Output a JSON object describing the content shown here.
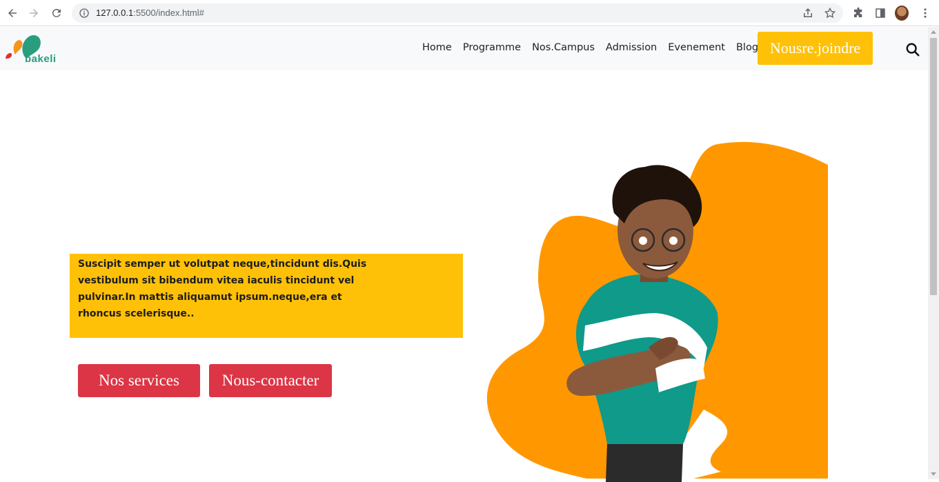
{
  "browser": {
    "url_host": "127.0.0.1",
    "url_rest": ":5500/index.html#"
  },
  "site": {
    "logo_text": "bakeli",
    "menu": [
      {
        "label": "Home"
      },
      {
        "label": "Programme"
      },
      {
        "label": "Nos.Campus"
      },
      {
        "label": "Admission"
      },
      {
        "label": "Evenement"
      },
      {
        "label": "Blog"
      }
    ],
    "join_label": "Nousre.joindre"
  },
  "hero": {
    "text": "Suscipit semper ut volutpat neque,tincidunt dis.Quis vestibulum sit bibendum vitea iaculis tincidunt vel pulvinar.In mattis aliquamut ipsum.neque,era et rhoncus scelerisque..",
    "services_label": "Nos services",
    "contact_label": "Nous-contacter"
  },
  "colors": {
    "accent_yellow": "#ffc107",
    "button_red": "#dc3545",
    "blob_orange": "#ff9800",
    "shirt_teal": "#0f9a8a"
  },
  "icons": [
    "back-arrow-icon",
    "forward-arrow-icon",
    "reload-icon",
    "info-icon",
    "share-icon",
    "star-icon",
    "extensions-icon",
    "side-panel-icon",
    "profile-avatar",
    "menu-dots-icon",
    "search-icon"
  ]
}
